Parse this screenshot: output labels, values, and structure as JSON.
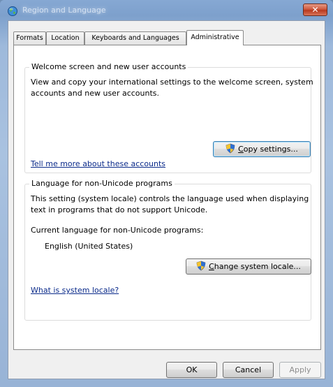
{
  "window": {
    "title": "Region and Language",
    "close_symbol": "✕",
    "title_icon": "globe-icon"
  },
  "tabs": [
    {
      "label": "Formats",
      "active": false
    },
    {
      "label": "Location",
      "active": false
    },
    {
      "label": "Keyboards and Languages",
      "active": false
    },
    {
      "label": "Administrative",
      "active": true
    }
  ],
  "welcome_group": {
    "title": "Welcome screen and new user accounts",
    "description_line1": "View and copy your international settings to the welcome screen, system",
    "description_line2": "accounts and new user accounts.",
    "copy_button": {
      "pre": "",
      "accel": "C",
      "post": "opy settings...",
      "icon": "uac-shield-icon"
    },
    "link": "Tell me more about these accounts"
  },
  "unicode_group": {
    "title": "Language for non-Unicode programs",
    "description_line1": "This setting (system locale) controls the language used when displaying",
    "description_line2": "text in programs that do not support Unicode.",
    "current_label": "Current language for non-Unicode programs:",
    "current_value": "English (United States)",
    "change_button": {
      "pre": "",
      "accel": "C",
      "post": "hange system locale...",
      "icon": "uac-shield-icon"
    },
    "link": "What is system locale?"
  },
  "footer": {
    "ok_label": "OK",
    "cancel_label": "Cancel",
    "apply_label": "Apply"
  }
}
